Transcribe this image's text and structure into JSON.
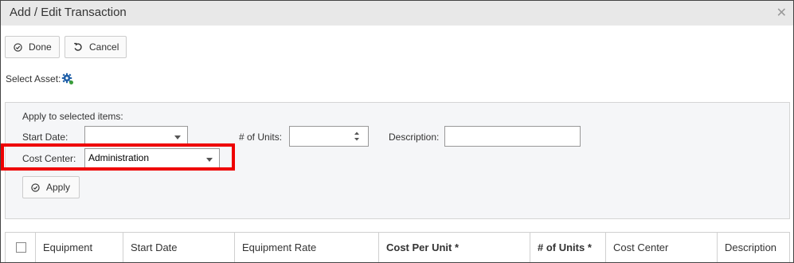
{
  "dialog": {
    "title": "Add / Edit Transaction"
  },
  "toolbar": {
    "done_label": "Done",
    "cancel_label": "Cancel"
  },
  "select_asset": {
    "label": "Select Asset:"
  },
  "apply_panel": {
    "heading": "Apply to selected items:",
    "start_date": {
      "label": "Start Date:",
      "value": ""
    },
    "units": {
      "label": "# of Units:",
      "value": ""
    },
    "description": {
      "label": "Description:",
      "value": ""
    },
    "cost_center": {
      "label": "Cost Center:",
      "value": "Administration"
    },
    "apply_label": "Apply"
  },
  "grid": {
    "columns": [
      {
        "label": "Equipment"
      },
      {
        "label": "Start Date"
      },
      {
        "label": "Equipment Rate"
      },
      {
        "label": "Cost Per Unit *"
      },
      {
        "label": "# of Units *"
      },
      {
        "label": "Cost Center"
      },
      {
        "label": "Description"
      }
    ]
  },
  "colors": {
    "titlebar": "#e8e8e8",
    "highlight": "#e00000",
    "panel": "#f5f6f8",
    "gear": "#1f5fa8"
  }
}
